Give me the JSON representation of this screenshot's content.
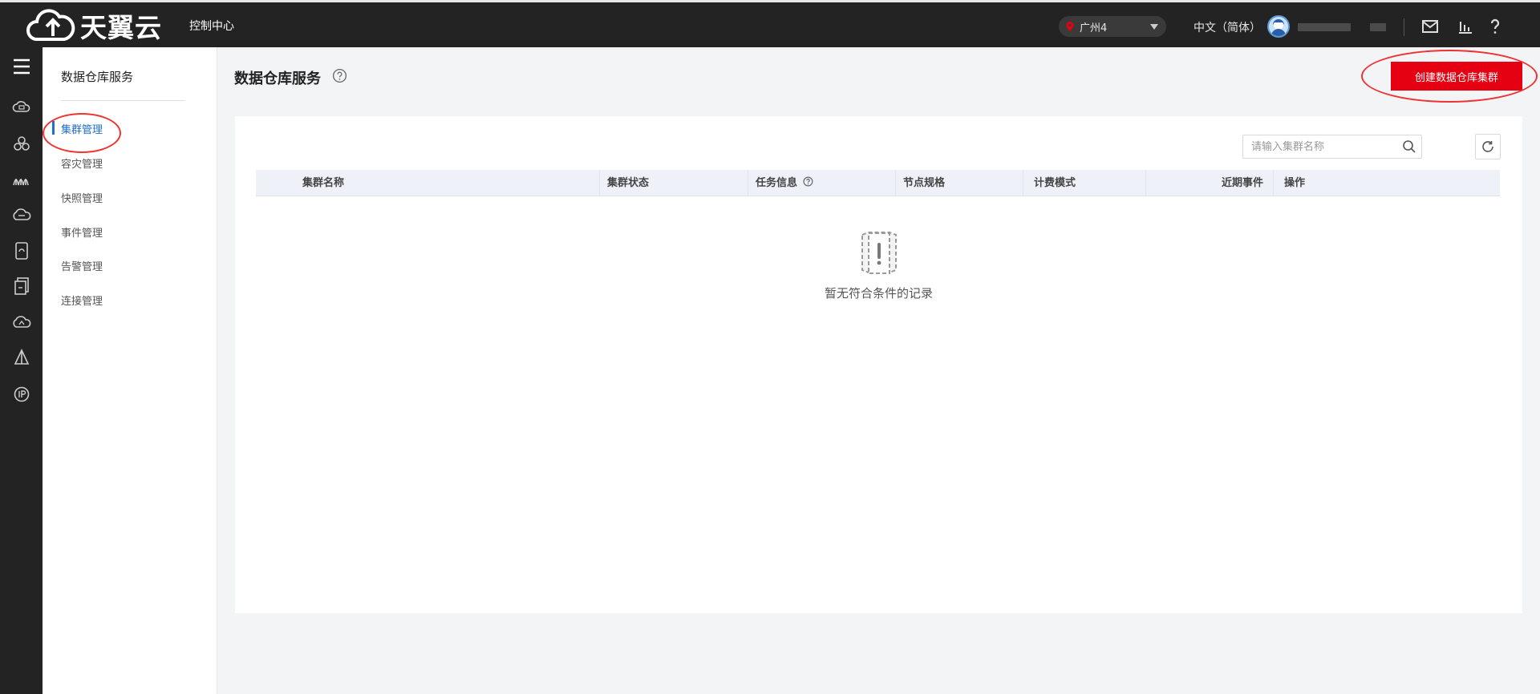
{
  "brand": {
    "name": "天翼云"
  },
  "topbar": {
    "console_label": "控制中心",
    "region": "广州4",
    "language": "中文（简体）"
  },
  "rail_icons": [
    "cloud-computer-icon",
    "network-nodes-icon",
    "bridge-icon",
    "cloud-storage-icon",
    "database-icon",
    "document-icon",
    "cloud-monitor-icon",
    "sailing-icon",
    "ip-icon"
  ],
  "sidebar": {
    "title": "数据仓库服务",
    "items": [
      {
        "label": "集群管理"
      },
      {
        "label": "容灾管理"
      },
      {
        "label": "快照管理"
      },
      {
        "label": "事件管理"
      },
      {
        "label": "告警管理"
      },
      {
        "label": "连接管理"
      }
    ]
  },
  "page": {
    "title": "数据仓库服务",
    "create_button": "创建数据仓库集群"
  },
  "search": {
    "placeholder": "请输入集群名称"
  },
  "table": {
    "columns": [
      "集群名称",
      "集群状态",
      "任务信息",
      "节点规格",
      "计费模式",
      "近期事件",
      "操作"
    ],
    "empty_text": "暂无符合条件的记录"
  },
  "colors": {
    "accent": "#e50012",
    "active": "#1f6fd0",
    "topbar": "#232323"
  }
}
